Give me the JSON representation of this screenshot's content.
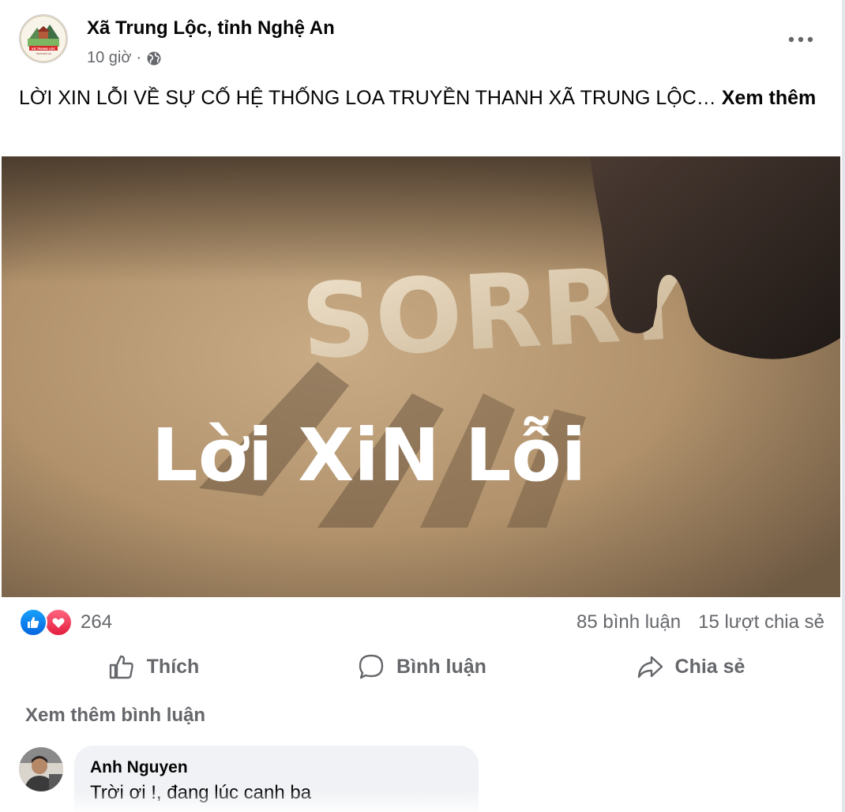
{
  "post": {
    "page_name": "Xã Trung Lộc, tỉnh Nghệ An",
    "time": "10 giờ",
    "separator": "·",
    "privacy_icon": "globe-icon",
    "text": "LỜI XIN LỖI VỀ SỰ CỐ HỆ THỐNG LOA TRUYỀN THANH XÃ TRUNG LỘC…",
    "see_more": "Xem thêm",
    "logo_text": "XÃ TRUNG LỘC",
    "logo_subtext": "TỈNH NGHỆ AN"
  },
  "image": {
    "word_top": "SORRY",
    "word_bottom": "Lời XiN Lỗi"
  },
  "stats": {
    "reaction_icons": [
      "like-icon",
      "love-icon"
    ],
    "reaction_count": "264",
    "comments": "85 bình luận",
    "shares": "15 lượt chia sẻ"
  },
  "actions": {
    "like": "Thích",
    "comment": "Bình luận",
    "share": "Chia sẻ"
  },
  "comments": {
    "see_more": "Xem thêm bình luận",
    "items": [
      {
        "author": "Anh Nguyen",
        "text": "Trời ơi !, đang lúc canh ba"
      }
    ]
  },
  "colors": {
    "primary_text": "#050505",
    "secondary_text": "#65676b",
    "like_blue": "#0866ff",
    "love_red": "#e41e3f",
    "bubble_bg": "#f0f2f5"
  }
}
